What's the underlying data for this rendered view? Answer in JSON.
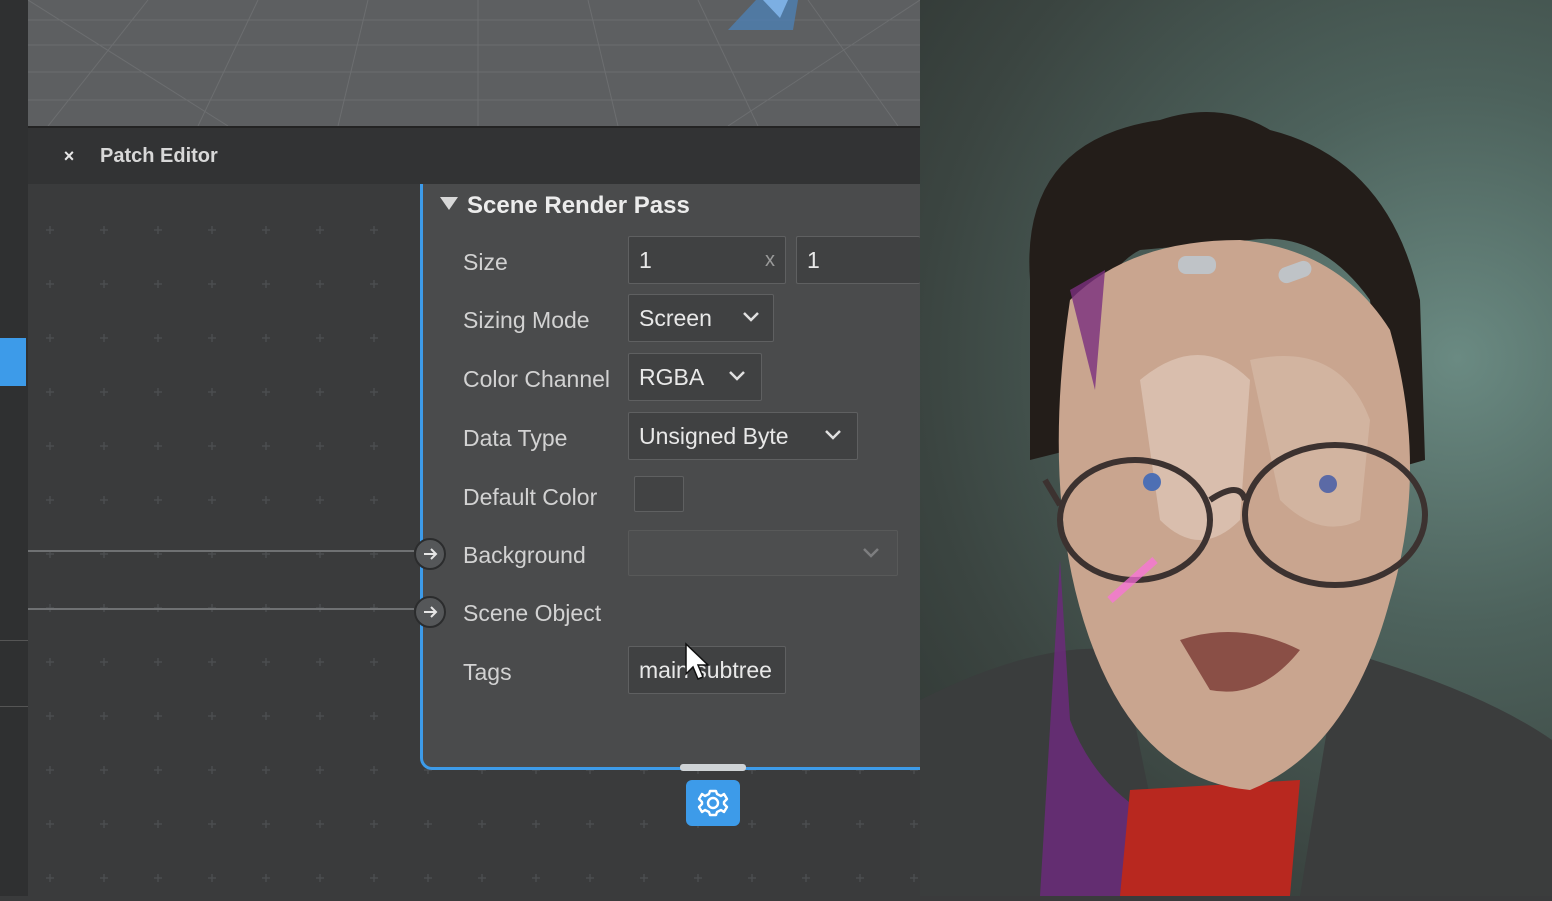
{
  "patch_editor": {
    "title": "Patch Editor",
    "close_label": "×"
  },
  "node": {
    "title": "Scene Render Pass",
    "properties": {
      "size": {
        "label": "Size",
        "width": "1",
        "separator": "x",
        "height": "1"
      },
      "sizing_mode": {
        "label": "Sizing Mode",
        "value": "Screen"
      },
      "color_channel": {
        "label": "Color Channel",
        "value": "RGBA"
      },
      "data_type": {
        "label": "Data Type",
        "value": "Unsigned Byte"
      },
      "default_color": {
        "label": "Default Color"
      },
      "background": {
        "label": "Background",
        "value": ""
      },
      "scene_object": {
        "label": "Scene Object"
      },
      "tags": {
        "label": "Tags",
        "value": "main subtree"
      }
    }
  },
  "colors": {
    "accent": "#3d9be9",
    "panel": "#4a4b4c",
    "canvas": "#3a3b3c",
    "header": "#323334"
  }
}
